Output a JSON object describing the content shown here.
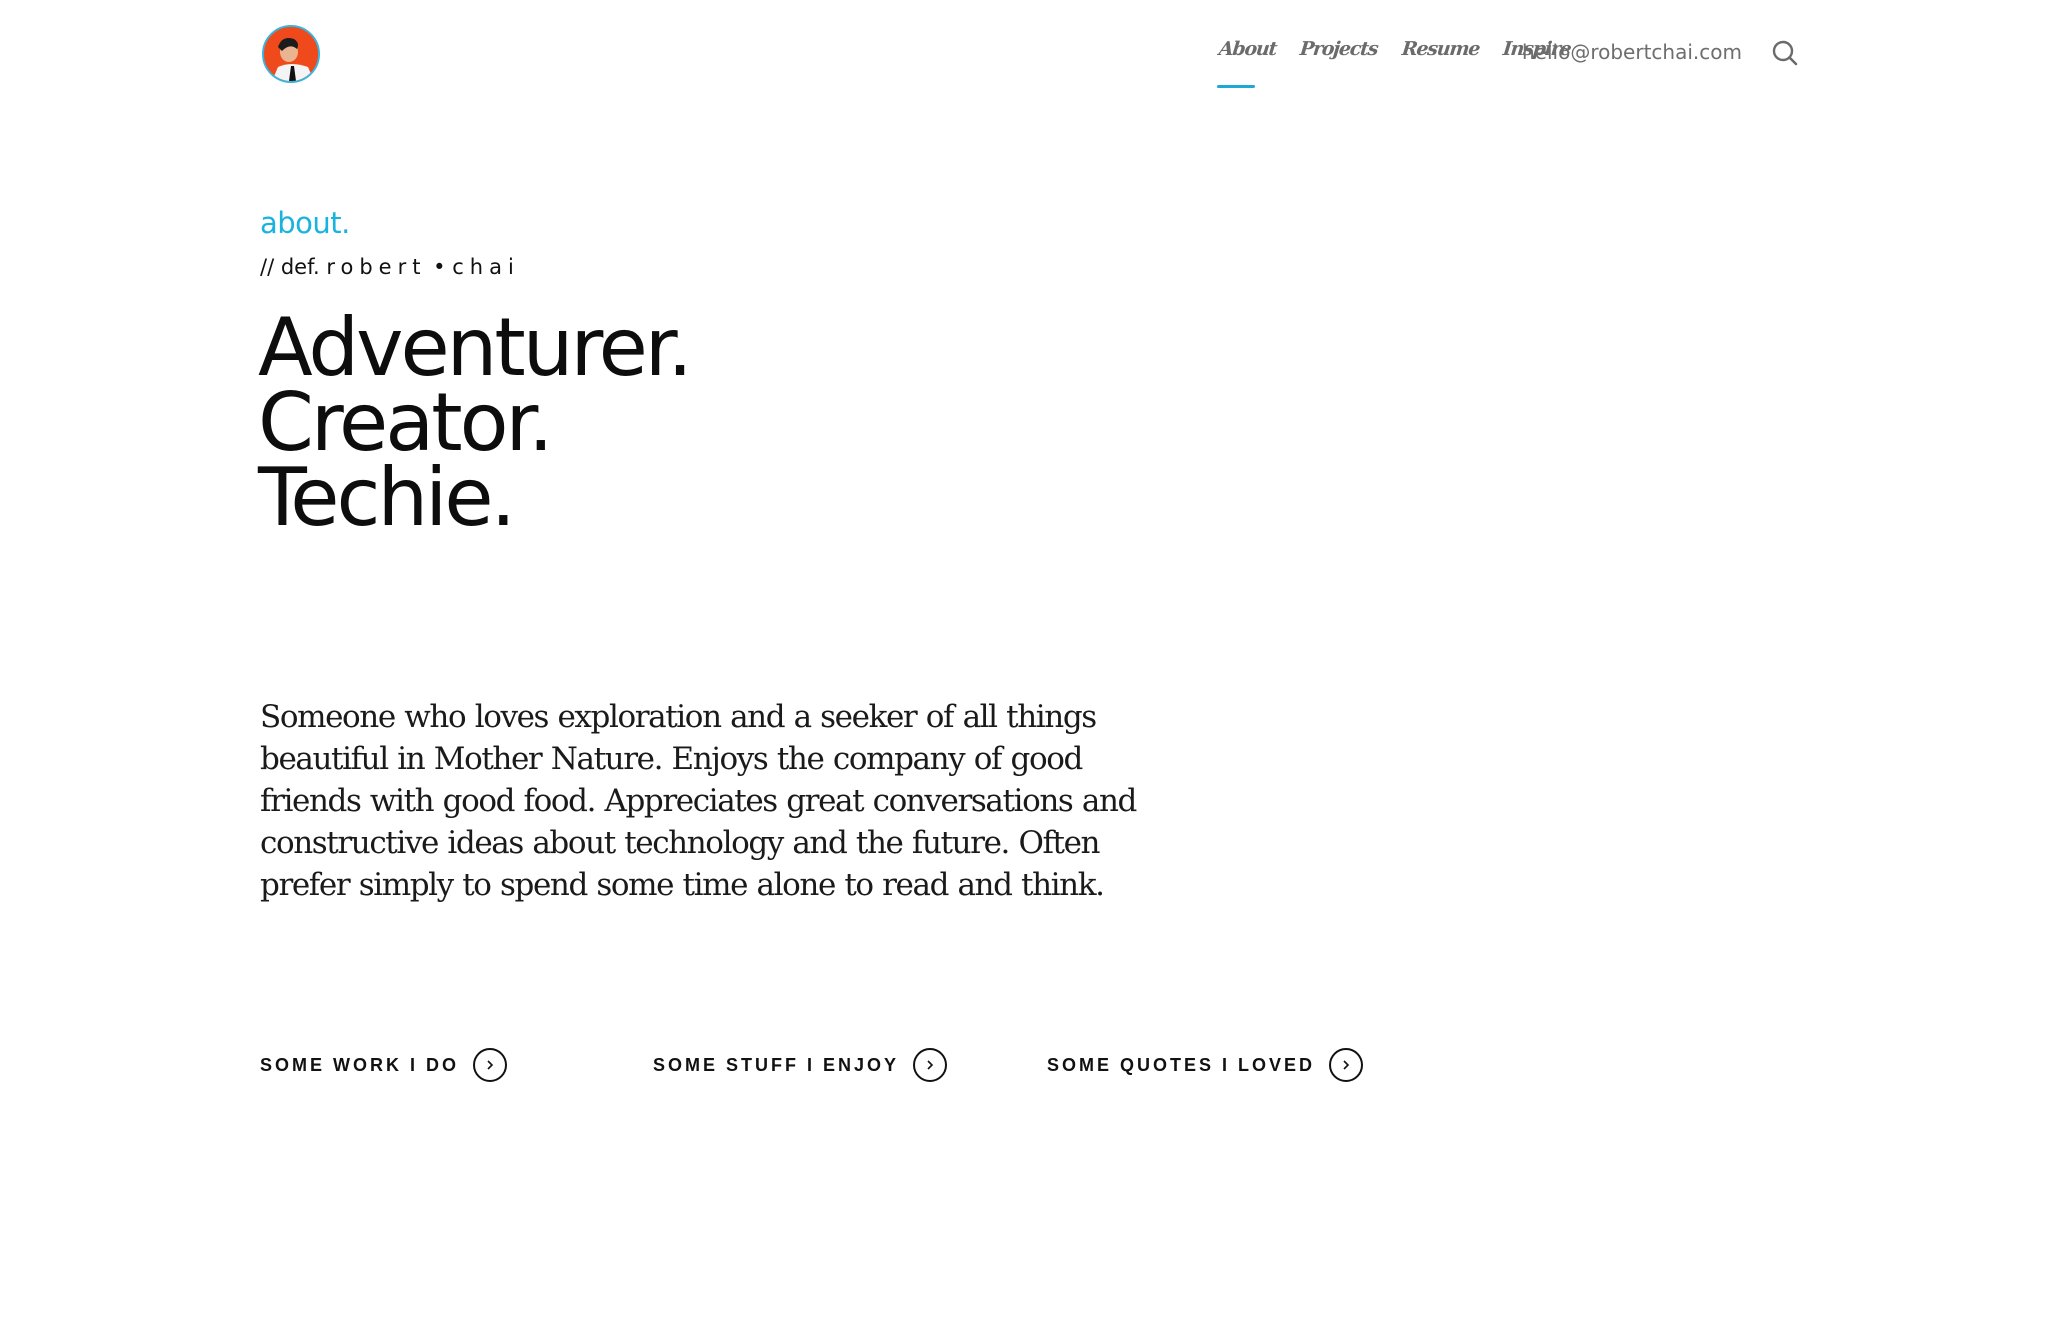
{
  "header": {
    "avatar_alt": "Robert Chai avatar",
    "nav": [
      {
        "label": "About",
        "active": true
      },
      {
        "label": "Projects",
        "active": false
      },
      {
        "label": "Resume",
        "active": false
      },
      {
        "label": "Inspire",
        "active": false
      }
    ],
    "email": "hello@robertchai.com",
    "search_icon": "search-icon"
  },
  "intro": {
    "section_label": "about.",
    "def_prefix": "// def.",
    "def_first": "robert",
    "def_separator": "•",
    "def_last": "chai",
    "headline": [
      "Adventurer.",
      "Creator.",
      "Techie."
    ],
    "bio": "Someone who loves exploration and a seeker of all things beautiful in Mother Nature. Enjoys the company of good friends with good food. Appreciates great conversations and constructive ideas about technology and the future. Often prefer simply to spend some time alone to read and think."
  },
  "links": [
    {
      "label": "SOME WORK I DO",
      "icon": "chevron-right-icon"
    },
    {
      "label": "SOME STUFF I ENJOY",
      "icon": "chevron-right-icon"
    },
    {
      "label": "SOME QUOTES I LOVED",
      "icon": "chevron-right-icon"
    }
  ],
  "colors": {
    "accent": "#1ab3e0",
    "nav_text": "#6b6b6b",
    "avatar_bg": "#f04a1c"
  }
}
